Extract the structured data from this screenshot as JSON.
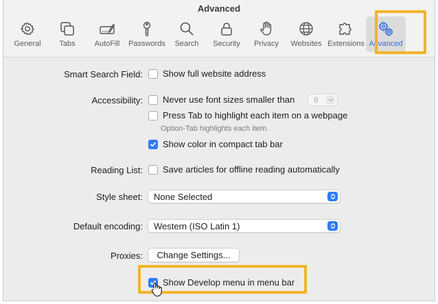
{
  "window": {
    "title": "Advanced"
  },
  "toolbar": {
    "items": [
      {
        "label": "General",
        "icon": "gear-icon"
      },
      {
        "label": "Tabs",
        "icon": "tabs-icon"
      },
      {
        "label": "AutoFill",
        "icon": "autofill-icon"
      },
      {
        "label": "Passwords",
        "icon": "key-icon"
      },
      {
        "label": "Search",
        "icon": "search-icon"
      },
      {
        "label": "Security",
        "icon": "lock-icon"
      },
      {
        "label": "Privacy",
        "icon": "hand-icon"
      },
      {
        "label": "Websites",
        "icon": "globe-icon"
      },
      {
        "label": "Extensions",
        "icon": "puzzle-icon"
      },
      {
        "label": "Advanced",
        "icon": "gears-icon",
        "selected": true
      }
    ],
    "accent_color": "#2f6fdd"
  },
  "settings": {
    "smart_search": {
      "label": "Smart Search Field:",
      "option": "Show full website address",
      "checked": false
    },
    "accessibility": {
      "label": "Accessibility:",
      "min_font": {
        "text": "Never use font sizes smaller than",
        "checked": false,
        "value": "9"
      },
      "press_tab": {
        "text": "Press Tab to highlight each item on a webpage",
        "checked": false
      },
      "hint": "Option-Tab highlights each item.",
      "compact_color": {
        "text": "Show color in compact tab bar",
        "checked": true
      }
    },
    "reading_list": {
      "label": "Reading List:",
      "option": "Save articles for offline reading automatically",
      "checked": false
    },
    "style_sheet": {
      "label": "Style sheet:",
      "value": "None Selected"
    },
    "encoding": {
      "label": "Default encoding:",
      "value": "Western (ISO Latin 1)"
    },
    "proxies": {
      "label": "Proxies:",
      "button": "Change Settings..."
    },
    "develop_menu": {
      "text": "Show Develop menu in menu bar",
      "checked": true
    }
  },
  "highlight_color": "#f0b429",
  "checkbox_color": "#2f7bf5"
}
